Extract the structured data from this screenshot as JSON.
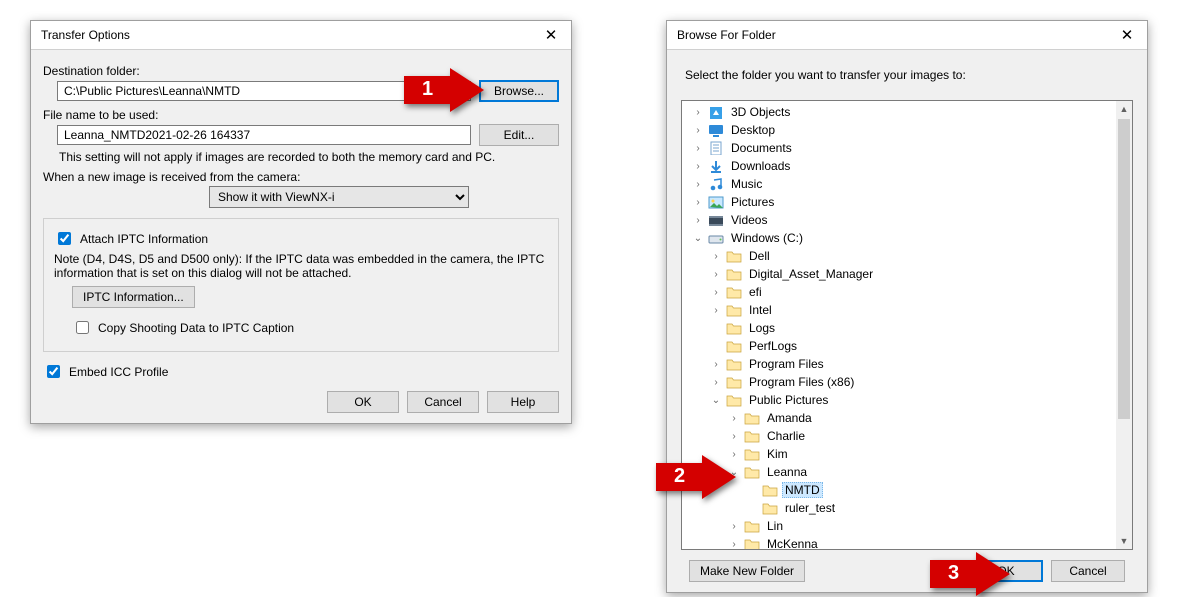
{
  "transfer": {
    "title": "Transfer Options",
    "dest_label": "Destination folder:",
    "dest_value": "C:\\Public Pictures\\Leanna\\NMTD",
    "browse_btn": "Browse...",
    "filename_label": "File name to be used:",
    "filename_value": "Leanna_NMTD2021-02-26 164337",
    "edit_btn": "Edit...",
    "filename_note": "This setting will not apply if images are recorded to both the memory card and PC.",
    "newimage_label": "When a new image is received from the camera:",
    "newimage_option": "Show it with ViewNX-i",
    "attach_iptc": "Attach IPTC Information",
    "iptc_note": "Note (D4, D4S, D5 and D500 only): If the IPTC data was embedded in the camera, the IPTC information that is set on this dialog will not be attached.",
    "iptc_btn": "IPTC Information...",
    "copy_shoot": "Copy Shooting Data to IPTC Caption",
    "embed_icc": "Embed ICC Profile",
    "ok": "OK",
    "cancel": "Cancel",
    "help": "Help"
  },
  "bff": {
    "title": "Browse For Folder",
    "instruction": "Select the folder you want to transfer your images to:",
    "make_new": "Make New Folder",
    "ok": "OK",
    "cancel": "Cancel",
    "tree": [
      {
        "indent": 0,
        "exp": ">",
        "icon": "3d",
        "label": "3D Objects"
      },
      {
        "indent": 0,
        "exp": ">",
        "icon": "desktop",
        "label": "Desktop"
      },
      {
        "indent": 0,
        "exp": ">",
        "icon": "doc",
        "label": "Documents"
      },
      {
        "indent": 0,
        "exp": ">",
        "icon": "down",
        "label": "Downloads"
      },
      {
        "indent": 0,
        "exp": ">",
        "icon": "music",
        "label": "Music"
      },
      {
        "indent": 0,
        "exp": ">",
        "icon": "pic",
        "label": "Pictures"
      },
      {
        "indent": 0,
        "exp": ">",
        "icon": "video",
        "label": "Videos"
      },
      {
        "indent": 0,
        "exp": "v",
        "icon": "drive",
        "label": "Windows (C:)"
      },
      {
        "indent": 1,
        "exp": ">",
        "icon": "folder",
        "label": "Dell"
      },
      {
        "indent": 1,
        "exp": ">",
        "icon": "folder",
        "label": "Digital_Asset_Manager"
      },
      {
        "indent": 1,
        "exp": ">",
        "icon": "folder",
        "label": "efi"
      },
      {
        "indent": 1,
        "exp": ">",
        "icon": "folder",
        "label": "Intel"
      },
      {
        "indent": 1,
        "exp": " ",
        "icon": "folder",
        "label": "Logs"
      },
      {
        "indent": 1,
        "exp": " ",
        "icon": "folder",
        "label": "PerfLogs"
      },
      {
        "indent": 1,
        "exp": ">",
        "icon": "folder",
        "label": "Program Files"
      },
      {
        "indent": 1,
        "exp": ">",
        "icon": "folder",
        "label": "Program Files (x86)"
      },
      {
        "indent": 1,
        "exp": "v",
        "icon": "folder",
        "label": "Public Pictures"
      },
      {
        "indent": 2,
        "exp": ">",
        "icon": "folder",
        "label": "Amanda"
      },
      {
        "indent": 2,
        "exp": ">",
        "icon": "folder",
        "label": "Charlie"
      },
      {
        "indent": 2,
        "exp": ">",
        "icon": "folder",
        "label": "Kim"
      },
      {
        "indent": 2,
        "exp": "v",
        "icon": "folder",
        "label": "Leanna"
      },
      {
        "indent": 3,
        "exp": " ",
        "icon": "folder",
        "label": "NMTD",
        "selected": true
      },
      {
        "indent": 3,
        "exp": " ",
        "icon": "folder",
        "label": "ruler_test"
      },
      {
        "indent": 2,
        "exp": ">",
        "icon": "folder",
        "label": "Lin"
      },
      {
        "indent": 2,
        "exp": ">",
        "icon": "folder",
        "label": "McKenna"
      }
    ]
  },
  "callouts": {
    "a1": "1",
    "a2": "2",
    "a3": "3"
  }
}
